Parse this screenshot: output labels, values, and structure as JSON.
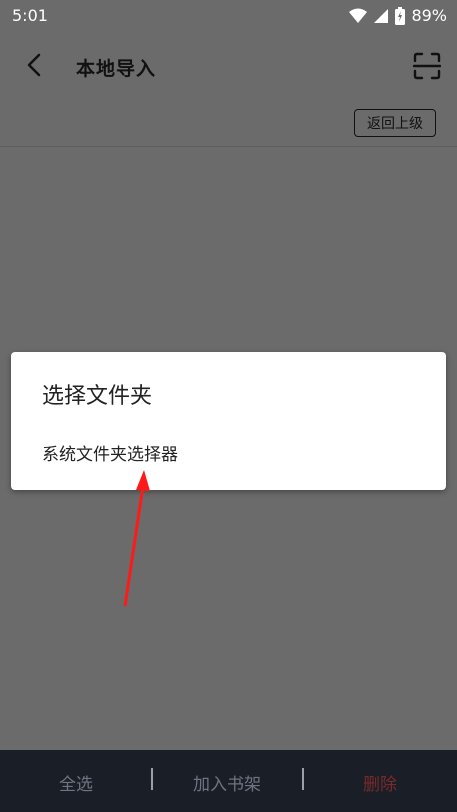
{
  "status_bar": {
    "time": "5:01",
    "battery": "89%"
  },
  "app_bar": {
    "title": "本地导入",
    "back_icon": "back-icon",
    "scan_icon": "scan-icon"
  },
  "toolbar": {
    "up_level_label": "返回上级"
  },
  "dialog": {
    "title": "选择文件夹",
    "option": "系统文件夹选择器"
  },
  "bottom_bar": {
    "select_all": "全选",
    "add_to_shelf": "加入书架",
    "delete": "删除",
    "delete_color": "#7a2a2a"
  },
  "colors": {
    "background": "#6b6b6b",
    "dialog": "#ffffff",
    "bottom_bar": "#1a1e27",
    "arrow": "#ff1a1a"
  }
}
